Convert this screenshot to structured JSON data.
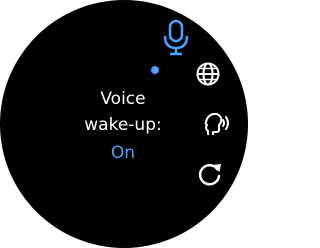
{
  "status": {
    "title_line1": "Voice",
    "title_line2": "wake-up:",
    "value": "On"
  },
  "colors": {
    "accent": "#4aa3ff",
    "text": "#ffffff",
    "background": "#000000"
  },
  "icons": [
    {
      "name": "microphone-icon",
      "active": true
    },
    {
      "name": "globe-icon"
    },
    {
      "name": "voice-feedback-icon"
    },
    {
      "name": "refresh-icon"
    }
  ]
}
